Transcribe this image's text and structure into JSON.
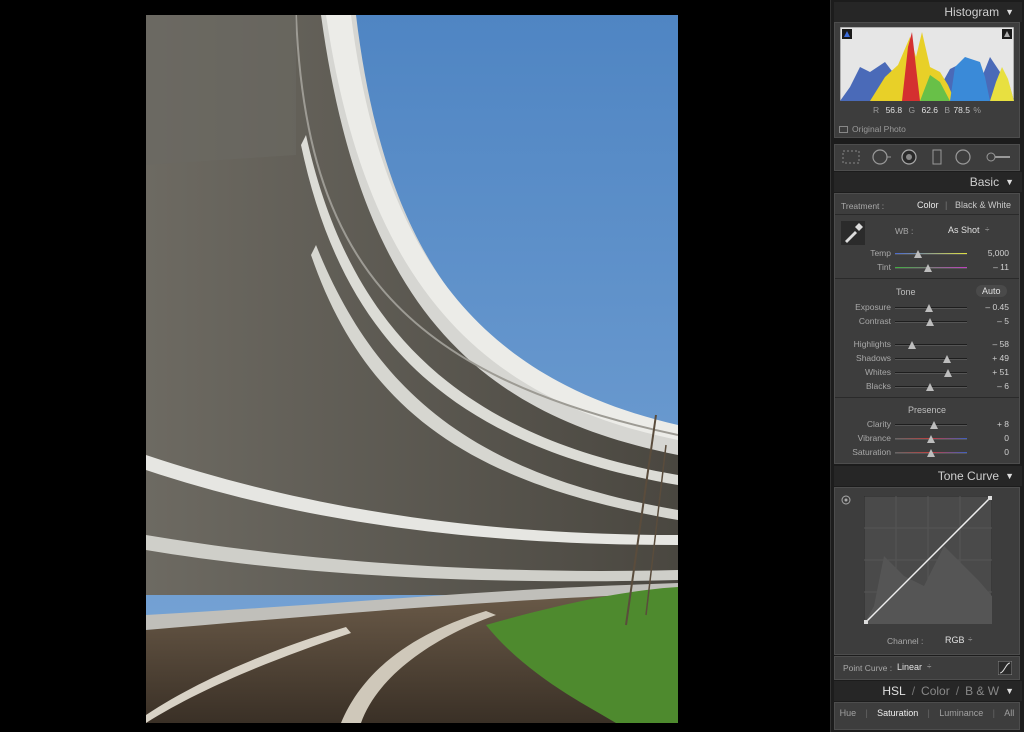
{
  "histogram": {
    "title": "Histogram",
    "r_label": "R",
    "r_value": "56.8",
    "g_label": "G",
    "g_value": "62.6",
    "b_label": "B",
    "b_value": "78.5",
    "pct": "%",
    "original_photo": "Original Photo"
  },
  "tools": [
    "crop-icon",
    "spot-removal-icon",
    "red-eye-icon",
    "graduated-filter-icon",
    "radial-filter-icon",
    "adjustment-brush-icon"
  ],
  "basic": {
    "title": "Basic",
    "treatment_label": "Treatment :",
    "treatment_color": "Color",
    "treatment_divider": "|",
    "treatment_bw": "Black & White",
    "wb_label": "WB :",
    "wb_value": "As Shot",
    "wb_arrow": "÷",
    "temp": {
      "label": "Temp",
      "value": "5,000",
      "pos": 0.32
    },
    "tint": {
      "label": "Tint",
      "value": "– 11",
      "pos": 0.46
    },
    "tone_label": "Tone",
    "auto_label": "Auto",
    "tone_sliders": [
      {
        "label": "Exposure",
        "value": "– 0.45",
        "pos": 0.47
      },
      {
        "label": "Contrast",
        "value": "– 5",
        "pos": 0.48
      }
    ],
    "tone_sliders2": [
      {
        "label": "Highlights",
        "value": "– 58",
        "pos": 0.24
      },
      {
        "label": "Shadows",
        "value": "+ 49",
        "pos": 0.72
      },
      {
        "label": "Whites",
        "value": "+ 51",
        "pos": 0.73
      },
      {
        "label": "Blacks",
        "value": "– 6",
        "pos": 0.48
      }
    ],
    "presence_label": "Presence",
    "presence_sliders": [
      {
        "label": "Clarity",
        "value": "+ 8",
        "pos": 0.54
      },
      {
        "label": "Vibrance",
        "value": "0",
        "pos": 0.5
      },
      {
        "label": "Saturation",
        "value": "0",
        "pos": 0.5
      }
    ]
  },
  "tone_curve": {
    "title": "Tone Curve",
    "channel_label": "Channel :",
    "channel_value": "RGB",
    "channel_arrow": "÷",
    "point_curve_label": "Point Curve :",
    "point_curve_value": "Linear",
    "point_curve_arrow": "÷"
  },
  "hsl": {
    "title_hsl": "HSL",
    "slash1": "/",
    "title_color": "Color",
    "slash2": "/",
    "title_bw": "B & W",
    "tabs": [
      "Hue",
      "Saturation",
      "Luminance",
      "All"
    ],
    "active_tab": "Saturation"
  },
  "colors": {
    "panel_bg": "#3d3d3d",
    "header_bg": "#262626",
    "sky": "#5a8cc6",
    "grass": "#4e8a2e"
  }
}
